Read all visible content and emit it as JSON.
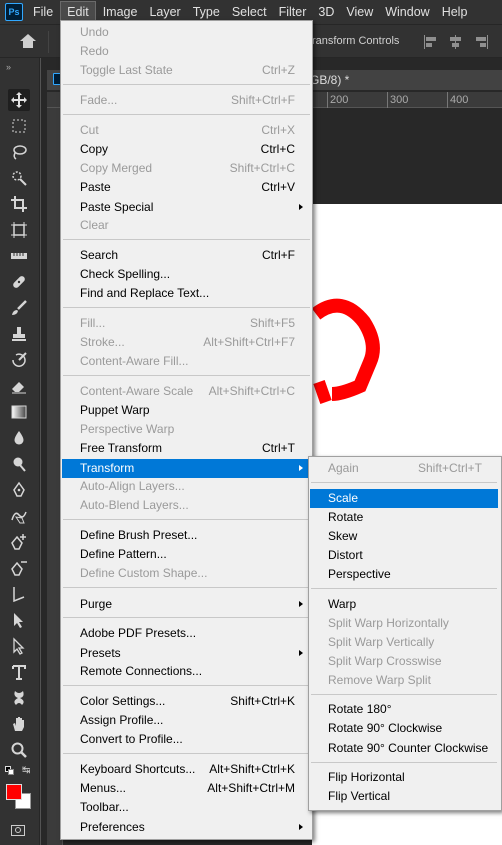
{
  "app": {
    "logo_text": "Ps"
  },
  "menubar": {
    "items": [
      "File",
      "Edit",
      "Image",
      "Layer",
      "Type",
      "Select",
      "Filter",
      "3D",
      "View",
      "Window",
      "Help"
    ],
    "active": "Edit"
  },
  "options_bar": {
    "partial_label": "ransform Controls"
  },
  "document": {
    "tab_title_partial": "GB/8) *",
    "ruler_ticks": [
      "200",
      "300",
      "400"
    ],
    "stroke_color": "#ff0000"
  },
  "colors": {
    "foreground": "#ff0000",
    "background": "#ffffff",
    "highlight": "#0078d7"
  },
  "edit_menu": {
    "undo": "Undo",
    "redo": "Redo",
    "toggle_last_state": {
      "label": "Toggle Last State",
      "shortcut": "Ctrl+Z"
    },
    "fade": {
      "label": "Fade...",
      "shortcut": "Shift+Ctrl+F"
    },
    "cut": {
      "label": "Cut",
      "shortcut": "Ctrl+X"
    },
    "copy": {
      "label": "Copy",
      "shortcut": "Ctrl+C"
    },
    "copy_merged": {
      "label": "Copy Merged",
      "shortcut": "Shift+Ctrl+C"
    },
    "paste": {
      "label": "Paste",
      "shortcut": "Ctrl+V"
    },
    "paste_special": "Paste Special",
    "clear": "Clear",
    "search": {
      "label": "Search",
      "shortcut": "Ctrl+F"
    },
    "check_spelling": "Check Spelling...",
    "find_replace": "Find and Replace Text...",
    "fill": {
      "label": "Fill...",
      "shortcut": "Shift+F5"
    },
    "stroke": {
      "label": "Stroke...",
      "shortcut": "Alt+Shift+Ctrl+F7"
    },
    "content_aware_fill": "Content-Aware Fill...",
    "content_aware_scale": {
      "label": "Content-Aware Scale",
      "shortcut": "Alt+Shift+Ctrl+C"
    },
    "puppet_warp": "Puppet Warp",
    "perspective_warp": "Perspective Warp",
    "free_transform": {
      "label": "Free Transform",
      "shortcut": "Ctrl+T"
    },
    "transform": "Transform",
    "auto_align": "Auto-Align Layers...",
    "auto_blend": "Auto-Blend Layers...",
    "define_brush": "Define Brush Preset...",
    "define_pattern": "Define Pattern...",
    "define_custom_shape": "Define Custom Shape...",
    "purge": "Purge",
    "adobe_pdf_presets": "Adobe PDF Presets...",
    "presets": "Presets",
    "remote_connections": "Remote Connections...",
    "color_settings": {
      "label": "Color Settings...",
      "shortcut": "Shift+Ctrl+K"
    },
    "assign_profile": "Assign Profile...",
    "convert_profile": "Convert to Profile...",
    "keyboard_shortcuts": {
      "label": "Keyboard Shortcuts...",
      "shortcut": "Alt+Shift+Ctrl+K"
    },
    "menus": {
      "label": "Menus...",
      "shortcut": "Alt+Shift+Ctrl+M"
    },
    "toolbar": "Toolbar...",
    "preferences": "Preferences"
  },
  "transform_menu": {
    "again": {
      "label": "Again",
      "shortcut": "Shift+Ctrl+T"
    },
    "scale": "Scale",
    "rotate": "Rotate",
    "skew": "Skew",
    "distort": "Distort",
    "perspective": "Perspective",
    "warp": "Warp",
    "split_h": "Split Warp Horizontally",
    "split_v": "Split Warp Vertically",
    "split_cross": "Split Warp Crosswise",
    "remove_split": "Remove Warp Split",
    "rotate180": "Rotate 180°",
    "rotate90cw": "Rotate 90° Clockwise",
    "rotate90ccw": "Rotate 90° Counter Clockwise",
    "flip_h": "Flip Horizontal",
    "flip_v": "Flip Vertical"
  }
}
